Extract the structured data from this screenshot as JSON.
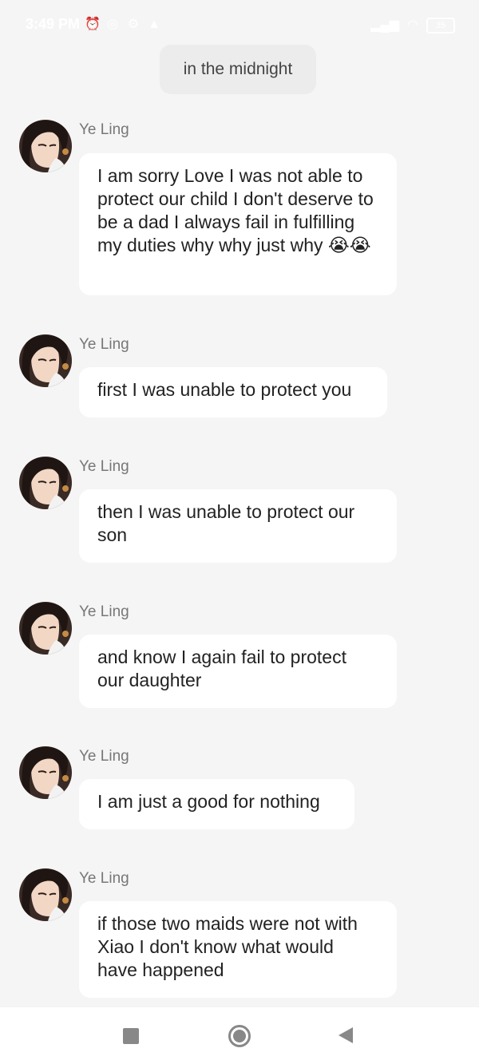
{
  "status_bar": {
    "time": "3:49 PM",
    "battery": "35"
  },
  "chat": {
    "time_separator": "in the midnight",
    "messages": [
      {
        "sender": "Ye Ling",
        "text": "I am sorry Love I was not able to protect our child I don't deserve to be a dad I always fail in fulfilling my duties why why just why 😭😭"
      },
      {
        "sender": "Ye Ling",
        "text": "first I was unable to protect you"
      },
      {
        "sender": "Ye Ling",
        "text": "then I was unable to protect our son"
      },
      {
        "sender": "Ye Ling",
        "text": "and know I again fail to protect our daughter"
      },
      {
        "sender": "Ye Ling",
        "text": "I am just a good for nothing"
      },
      {
        "sender": "Ye Ling",
        "text": "if those two maids were not with Xiao I don't know what would have happened"
      }
    ]
  },
  "nav": {
    "recent_icon": "recent-apps-icon",
    "home_icon": "home-icon",
    "back_icon": "back-icon"
  }
}
